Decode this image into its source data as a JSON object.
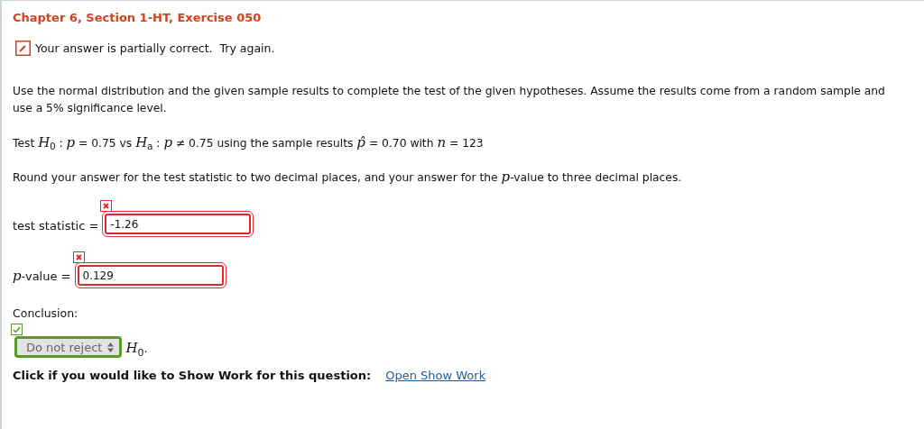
{
  "title": "Chapter 6, Section 1-HT, Exercise 050",
  "feedback": {
    "partial": true,
    "text": "Your answer is partially correct.  Try again."
  },
  "instructions": "Use the normal distribution and the given sample results to complete the test of the given hypotheses. Assume the results come from a random sample and use a 5% significance level.",
  "hypotheses": "Test *H*$_{0}$ : *p* = 0.75 vs *H*$_{a}$ : *p* ≠ 0.75 using the sample results *p̂* = 0.70 with *n* = 123",
  "rounding": "Round your answer for the test statistic to two decimal places, and your answer for the *p*-value to three decimal places.",
  "answers": [
    {
      "label": "test statistic =",
      "value": "-1.26",
      "correct": false
    },
    {
      "label": "*p*-value =",
      "value": "0.129",
      "correct": false
    }
  ],
  "conclusion": {
    "label": "Conclusion:",
    "value": "Do not reject",
    "correct": true,
    "after": "*H*$_{0}$."
  },
  "show_work": {
    "prompt": "Click if you would like to Show Work for this question:",
    "link": "Open Show Work"
  }
}
